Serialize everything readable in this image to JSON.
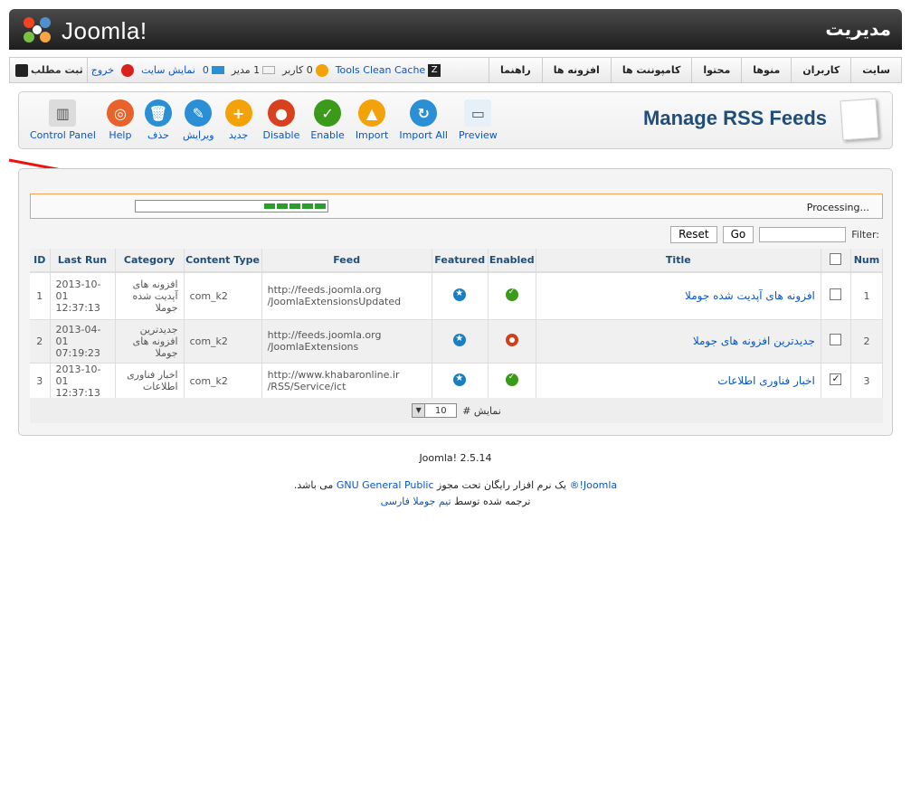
{
  "header": {
    "logo": "Joomla!",
    "title": "مدیریت"
  },
  "menu": {
    "items": [
      "سایت",
      "کاربران",
      "منوها",
      "محتوا",
      "کامپوننت ها",
      "افزونه ها",
      "راهنما"
    ],
    "tools_clean_cache": "Tools Clean Cache",
    "users_count": "0 کاربر",
    "admins_count": "1 مدیر",
    "messages_count": "0",
    "view_site": "نمایش سایت",
    "logout": "خروج",
    "register": "ثبت مطلب"
  },
  "toolbar": {
    "heading": "Manage RSS Feeds",
    "buttons": [
      {
        "label": "Control Panel",
        "icon": "control-panel-icon",
        "color": "#dcdcdc",
        "glyph": "▥"
      },
      {
        "label": "Help",
        "icon": "lifebuoy-icon",
        "color": "#e8632b",
        "glyph": "◎"
      },
      {
        "label": "حذف",
        "icon": "trash-icon",
        "color": "#2b8fd6",
        "glyph": "🗑"
      },
      {
        "label": "ویرایش",
        "icon": "pencil-icon",
        "color": "#2b8fd6",
        "glyph": "✎"
      },
      {
        "label": "جدید",
        "icon": "plus-icon",
        "color": "#f4a20a",
        "glyph": "+"
      },
      {
        "label": "Disable",
        "icon": "disable-icon",
        "color": "#d9411e",
        "glyph": "●"
      },
      {
        "label": "Enable",
        "icon": "enable-icon",
        "color": "#3a9a1a",
        "glyph": "✓"
      },
      {
        "label": "Import",
        "icon": "import-icon",
        "color": "#f4a20a",
        "glyph": "▲"
      },
      {
        "label": "Import All",
        "icon": "refresh-icon",
        "color": "#2b8fd6",
        "glyph": "↻"
      },
      {
        "label": "Preview",
        "icon": "preview-icon",
        "color": "#e6f0f8",
        "glyph": "▭"
      }
    ]
  },
  "processing": {
    "text": "Processing...",
    "progress_blocks": 5
  },
  "filter": {
    "label": "Filter:",
    "value": "",
    "go": "Go",
    "reset": "Reset"
  },
  "table": {
    "headers": {
      "num": "Num",
      "title": "Title",
      "enabled": "Enabled",
      "featured": "Featured",
      "feed": "Feed",
      "content_type": "Content Type",
      "category": "Category",
      "last_run": "Last Run",
      "id": "ID"
    },
    "rows": [
      {
        "num": "1",
        "title": "افزونه های آپدیت شده جوملا",
        "checked": false,
        "enabled": true,
        "feed1": "http://feeds.joomla.org",
        "feed2": "/JoomlaExtensionsUpdated",
        "content_type": "com_k2",
        "category": "افزونه های آپدیت شده جوملا",
        "last_run1": "2013-10-01",
        "last_run2": "12:37:13",
        "id": "1"
      },
      {
        "num": "2",
        "title": "جدیدترین افزونه های جوملا",
        "checked": false,
        "enabled": false,
        "feed1": "http://feeds.joomla.org",
        "feed2": "/JoomlaExtensions",
        "content_type": "com_k2",
        "category": "جدیدترین افزونه های جوملا",
        "last_run1": "2013-04-01",
        "last_run2": "07:19:23",
        "id": "2"
      },
      {
        "num": "3",
        "title": "اخبار فناوری اطلاعات",
        "checked": true,
        "enabled": true,
        "feed1": "http://www.khabaronline.ir",
        "feed2": "/RSS/Service/ict",
        "content_type": "com_k2",
        "category": "اخبار فناوری اطلاعات",
        "last_run1": "2013-10-01",
        "last_run2": "12:37:13",
        "id": "3"
      }
    ],
    "display_label": "نمایش #",
    "display_value": "10"
  },
  "footer": {
    "version": "Joomla! 2.5.14",
    "joomla_link": "Joomla!®",
    "license_prefix": " یک نرم افزار رایگان تحت مجوز ",
    "license_link": "GNU General Public",
    "license_suffix": " می باشد.",
    "translated_prefix": "ترجمه شده توسط ",
    "translated_link": "تیم جوملا فارسی"
  }
}
